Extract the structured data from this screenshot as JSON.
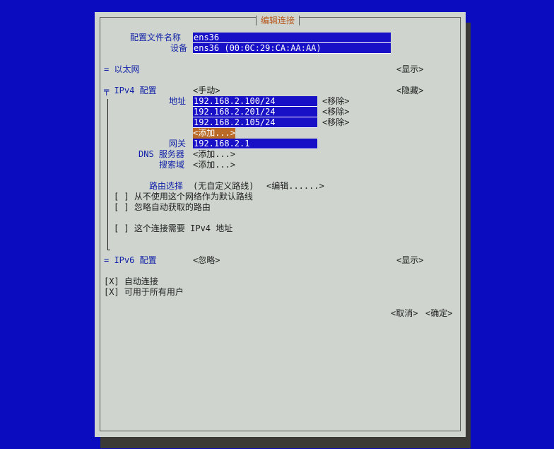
{
  "dialog": {
    "title": "编辑连接",
    "profile_name_label": "配置文件名称",
    "profile_name_value": "ens36",
    "device_label": "设备",
    "device_value": "ens36 (00:0C:29:CA:AA:AA)"
  },
  "ethernet": {
    "label": "= 以太网",
    "toggle": "<显示>"
  },
  "ipv4": {
    "label": "╤ IPv4 配置",
    "mode": "<手动>",
    "toggle": "<隐藏>",
    "address_label": "地址",
    "addresses": [
      "192.168.2.100/24",
      "192.168.2.201/24",
      "192.168.2.105/24"
    ],
    "remove_label": "<移除>",
    "add_label": "<添加...>",
    "gateway_label": "网关",
    "gateway_value": "192.168.2.1",
    "dns_label": "DNS 服务器",
    "dns_add": "<添加...>",
    "search_label": "搜索域",
    "search_add": "<添加...>",
    "routing_label": "路由选择",
    "routing_value": "(无自定义路线)",
    "routing_edit": "<编辑......>",
    "never_default": "[ ] 从不使用这个网络作为默认路线",
    "ignore_auto_routes": "[ ] 忽略自动获取的路由",
    "require_ipv4": "[ ] 这个连接需要 IPv4 地址"
  },
  "ipv6": {
    "label": "= IPv6 配置",
    "mode": "<忽略>",
    "toggle": "<显示>"
  },
  "options": {
    "auto_connect": "[X] 自动连接",
    "all_users": "[X] 可用于所有用户"
  },
  "buttons": {
    "cancel": "<取消>",
    "ok": "<确定>"
  },
  "colors": {
    "desktop": "#0b0bc0",
    "dialog_bg": "#cfd5ce",
    "field_bg": "#1710c6",
    "highlight": "#b86a26",
    "title": "#b5561c",
    "label_blue": "#0f1fa8"
  }
}
